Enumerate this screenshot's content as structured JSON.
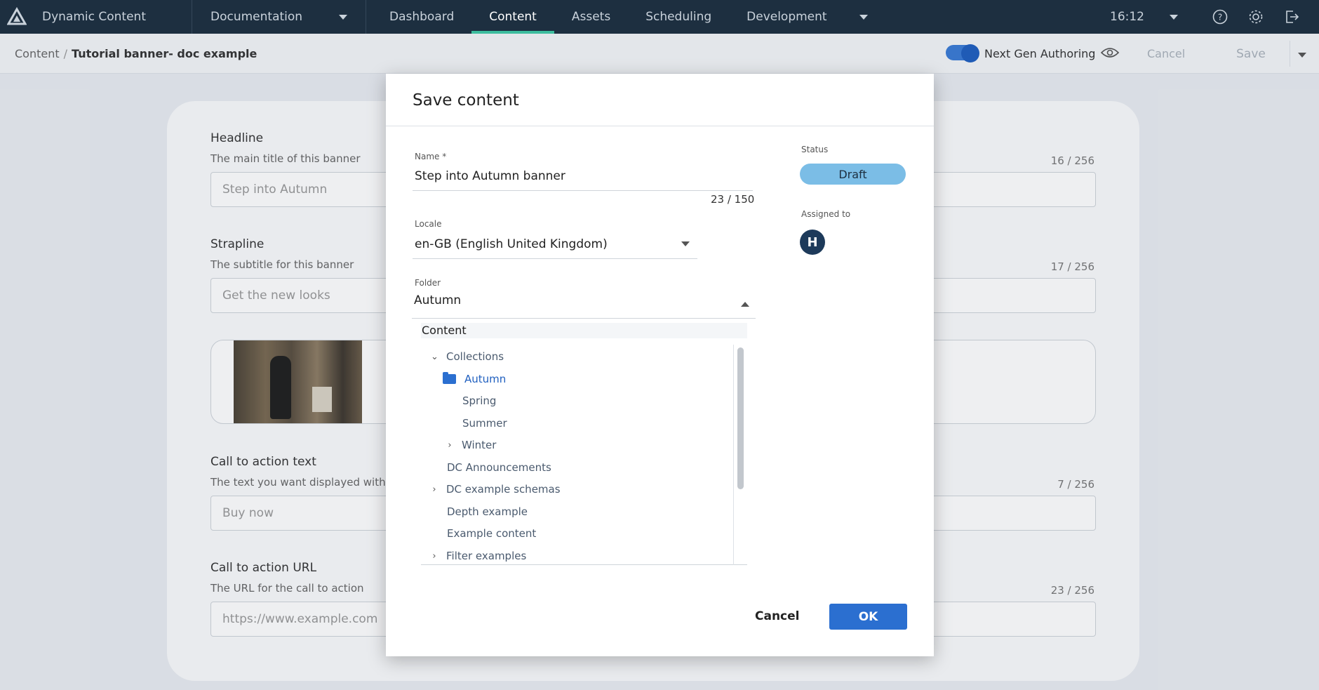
{
  "topnav": {
    "app_title": "Dynamic Content",
    "hub": "Documentation",
    "links": [
      {
        "label": "Dashboard"
      },
      {
        "label": "Content"
      },
      {
        "label": "Assets"
      },
      {
        "label": "Scheduling"
      },
      {
        "label": "Development"
      }
    ],
    "time": "16:12"
  },
  "subheader": {
    "breadcrumb_root": "Content",
    "breadcrumb_current": "Tutorial banner- doc example",
    "toggle_label": "Next Gen Authoring",
    "cancel_label": "Cancel",
    "save_label": "Save"
  },
  "form": {
    "headline": {
      "label": "Headline",
      "desc": "The main title of this banner",
      "value": "Step into Autumn",
      "count": "16 / 256"
    },
    "strapline": {
      "label": "Strapline",
      "desc": "The subtitle for this banner",
      "value": "Get the new looks",
      "count": "17 / 256"
    },
    "cta_text": {
      "label": "Call to action text",
      "desc": "The text you want displayed with the",
      "value": "Buy now",
      "count": "7 / 256"
    },
    "cta_url": {
      "label": "Call to action URL",
      "desc": "The URL for the call to action",
      "value": "https://www.example.com",
      "count": "23 / 256"
    }
  },
  "modal": {
    "title": "Save content",
    "name_label": "Name *",
    "name_value": "Step into Autumn banner",
    "name_count": "23 / 150",
    "locale_label": "Locale",
    "locale_value": "en-GB (English United Kingdom)",
    "folder_label": "Folder",
    "folder_value": "Autumn",
    "tree_root": "Content",
    "tree": [
      {
        "label": "Collections"
      },
      {
        "label": "Autumn"
      },
      {
        "label": "Spring"
      },
      {
        "label": "Summer"
      },
      {
        "label": "Winter"
      },
      {
        "label": "DC Announcements"
      },
      {
        "label": "DC example schemas"
      },
      {
        "label": "Depth example"
      },
      {
        "label": "Example content"
      },
      {
        "label": "Filter examples"
      }
    ],
    "status_label": "Status",
    "status_value": "Draft",
    "assigned_label": "Assigned to",
    "assigned_initial": "H",
    "cancel_label": "Cancel",
    "ok_label": "OK"
  },
  "colors": {
    "nav_bg": "#1d2f40",
    "accent": "#2b6fd0",
    "active_tab": "#3dbd9e",
    "status_badge": "#7bbde6"
  }
}
